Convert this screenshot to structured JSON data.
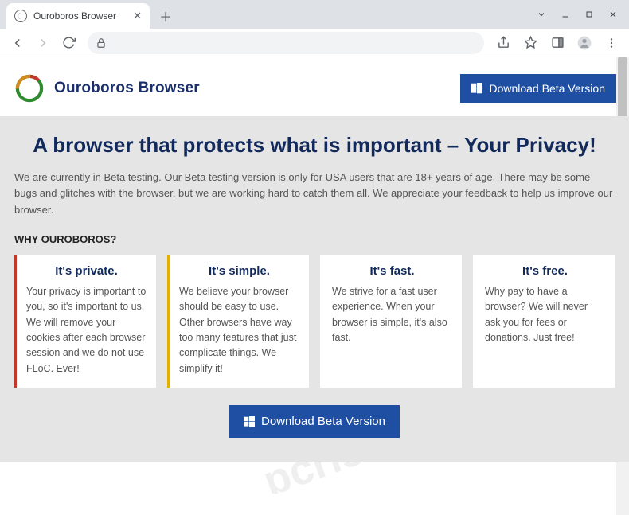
{
  "window": {
    "tab_title": "Ouroboros Browser"
  },
  "header": {
    "brand": "Ouroboros Browser",
    "download_label": "Download Beta Version"
  },
  "hero": {
    "title": "A browser that protects what is important – Your Privacy!",
    "beta_text": "We are currently in Beta testing. Our Beta testing version is only for USA users that are 18+ years of age. There may be some bugs and glitches with the browser, but we are working hard to catch them all. We appreciate your feedback to help us improve our browser.",
    "why_label": "WHY OUROBOROS?"
  },
  "cards": [
    {
      "title": "It's private.",
      "body": "Your privacy is important to you, so it's important to us. We will remove your cookies after each browser session and we do not use FLoC. Ever!"
    },
    {
      "title": "It's simple.",
      "body": "We believe your browser should be easy to use. Other browsers have way too many features that just complicate things. We simplify it!"
    },
    {
      "title": "It's fast.",
      "body": "We strive for a fast user experience. When your browser is simple, it's also fast."
    },
    {
      "title": "It's free.",
      "body": "Why pay to have a browser? We will never ask you for fees or donations. Just free!"
    }
  ],
  "cta": {
    "download_label": "Download Beta Version"
  },
  "watermark_text": "pcrisk.com"
}
